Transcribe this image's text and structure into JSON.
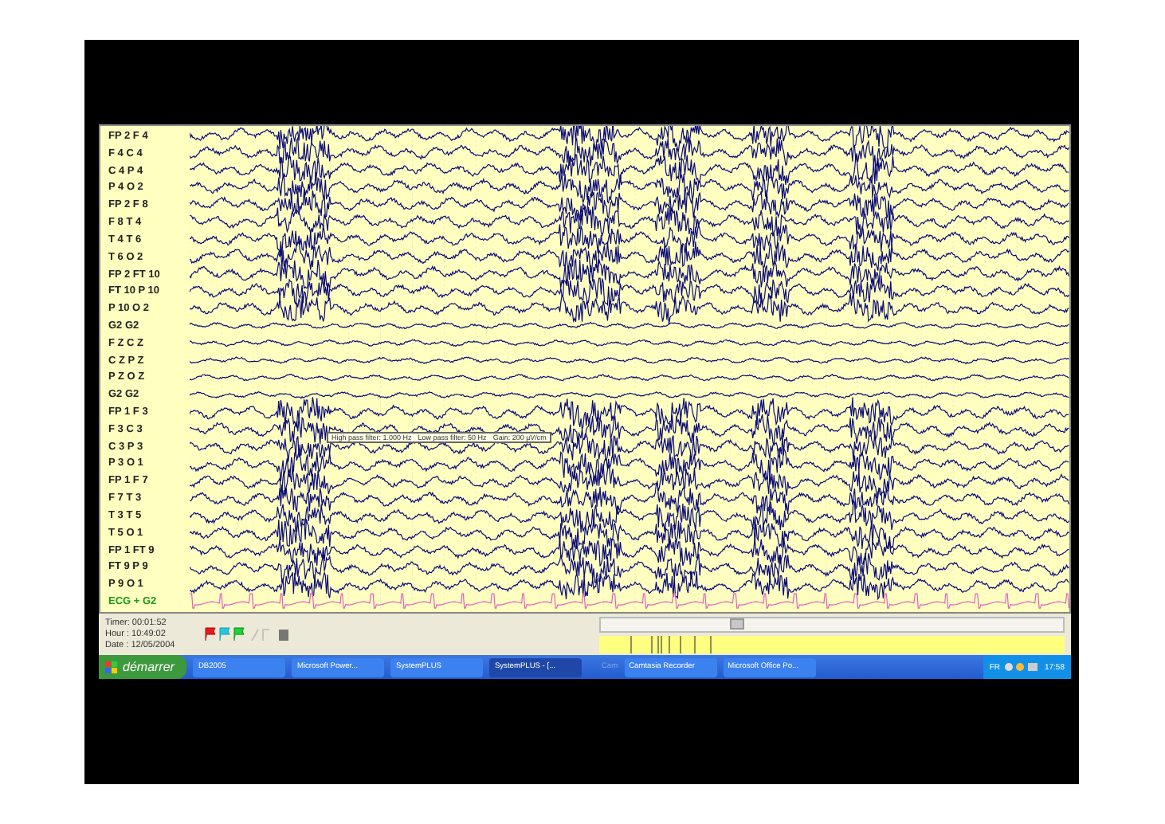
{
  "channels": [
    {
      "label": "FP 2 F 4",
      "kind": "eeg"
    },
    {
      "label": "F 4 C 4",
      "kind": "eeg"
    },
    {
      "label": "C 4 P 4",
      "kind": "eeg"
    },
    {
      "label": "P 4 O 2",
      "kind": "eeg"
    },
    {
      "label": "FP 2 F 8",
      "kind": "eeg"
    },
    {
      "label": "F 8 T 4",
      "kind": "eeg"
    },
    {
      "label": "T 4 T 6",
      "kind": "eeg"
    },
    {
      "label": "T 6 O 2",
      "kind": "eeg"
    },
    {
      "label": "FP 2 FT 10",
      "kind": "eeg"
    },
    {
      "label": "FT 10 P 10",
      "kind": "eeg"
    },
    {
      "label": "P 10 O 2",
      "kind": "eeg"
    },
    {
      "label": "G2 G2",
      "kind": "quiet"
    },
    {
      "label": "F Z C Z",
      "kind": "quiet"
    },
    {
      "label": "C Z P Z",
      "kind": "quiet"
    },
    {
      "label": "P Z O Z",
      "kind": "quiet"
    },
    {
      "label": "G2 G2",
      "kind": "quiet"
    },
    {
      "label": "FP 1 F 3",
      "kind": "eeg"
    },
    {
      "label": "F 3 C 3",
      "kind": "eeg"
    },
    {
      "label": "C 3 P 3",
      "kind": "eeg"
    },
    {
      "label": "P 3 O 1",
      "kind": "eeg"
    },
    {
      "label": "FP 1 F 7",
      "kind": "eeg"
    },
    {
      "label": "F 7 T 3",
      "kind": "eeg"
    },
    {
      "label": "T 3 T 5",
      "kind": "eeg"
    },
    {
      "label": "T 5 O 1",
      "kind": "eeg"
    },
    {
      "label": "FP 1 FT 9",
      "kind": "eeg"
    },
    {
      "label": "FT 9 P 9",
      "kind": "eeg"
    },
    {
      "label": "P 9 O 1",
      "kind": "eeg"
    },
    {
      "label": "ECG + G2",
      "kind": "ecg"
    }
  ],
  "filter_tooltip": [
    "High pass filter: 1.000 Hz",
    "Low pass filter: 50 Hz",
    "Gain: 200 µV/cm"
  ],
  "info": [
    "Timer: 00:01:52",
    "Hour : 10:49:02",
    "Date : 12/05/2004"
  ],
  "taskbar": {
    "start": "démarrer",
    "buttons": [
      {
        "label": "DB2005",
        "selected": false
      },
      {
        "label": "Microsoft Power...",
        "selected": false
      },
      {
        "label": "SystemPLUS",
        "selected": false
      },
      {
        "label": "SystemPLUS - [...",
        "selected": true
      }
    ],
    "tray_buttons": [
      "Camtasia Recorder",
      "Microsoft Office Po..."
    ],
    "tray_hint": "Cam",
    "language": "FR",
    "clock": "17:58"
  }
}
